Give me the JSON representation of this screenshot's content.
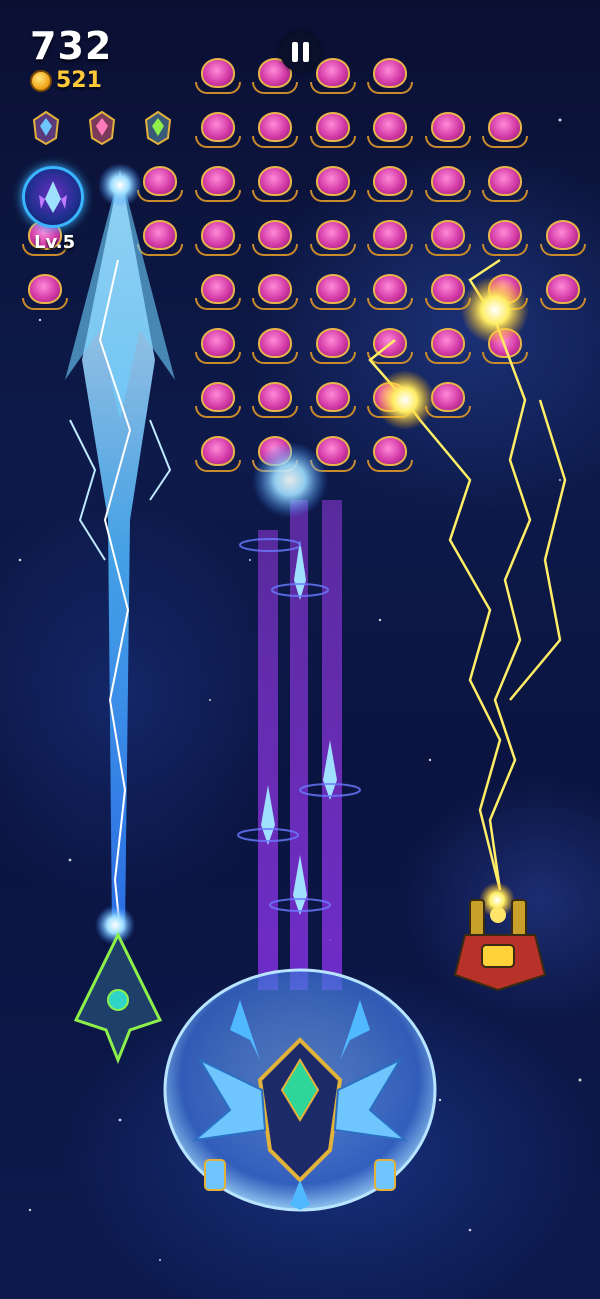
{
  "hud": {
    "score": "732",
    "coins": "521",
    "level": "Lv.5"
  },
  "icons": {
    "pause": "pause-icon",
    "coin": "coin-icon",
    "skill": "special-skill-icon",
    "wingman_badge": "wingman-badge-icon"
  },
  "colors": {
    "background": "#0b1440",
    "coin_text": "#ffc93a",
    "laser_blue": "#4fb8ff",
    "lightning_yellow": "#ffee66",
    "beam_purple": "#7a2fd6",
    "enemy_pink": "#d43ba7"
  },
  "enemy_grid": {
    "rows": [
      [
        0,
        0,
        0,
        1,
        1,
        1,
        1,
        0,
        0
      ],
      [
        0,
        0,
        0,
        1,
        1,
        1,
        1,
        1,
        1
      ],
      [
        0,
        0,
        1,
        1,
        1,
        1,
        1,
        1,
        1
      ],
      [
        1,
        0,
        1,
        1,
        1,
        1,
        1,
        1,
        1,
        1
      ],
      [
        1,
        0,
        0,
        1,
        1,
        1,
        1,
        1,
        1,
        1
      ],
      [
        0,
        0,
        0,
        1,
        1,
        1,
        1,
        1,
        1,
        0
      ],
      [
        0,
        0,
        0,
        1,
        1,
        1,
        1,
        1,
        0,
        0
      ],
      [
        0,
        0,
        0,
        1,
        1,
        1,
        1,
        0,
        0,
        0
      ]
    ]
  }
}
